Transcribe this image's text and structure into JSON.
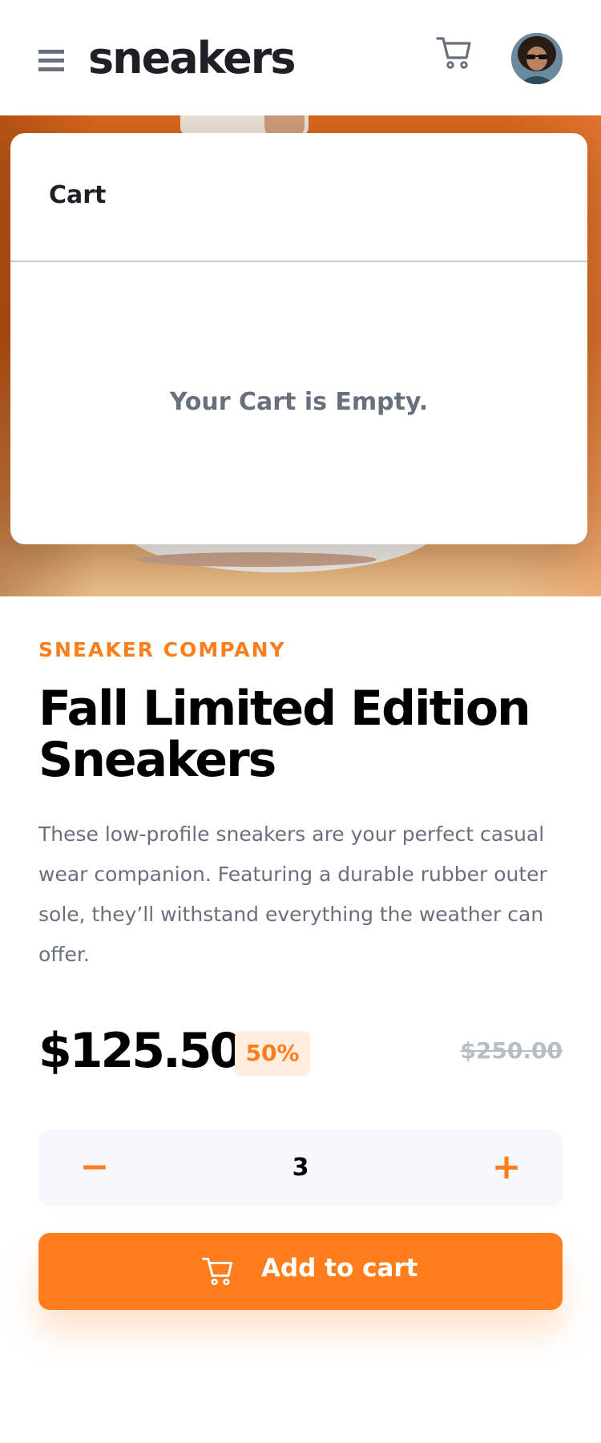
{
  "header": {
    "logo": "sneakers",
    "menu_icon": "hamburger-menu-icon",
    "cart_icon": "cart-icon",
    "avatar_icon": "user-avatar"
  },
  "cart": {
    "title": "Cart",
    "empty_message": "Your Cart is Empty."
  },
  "product": {
    "company": "SNEAKER COMPANY",
    "title": "Fall Limited Edition Sneakers",
    "description": "These low-profile sneakers are your perfect casual wear companion. Featuring a durable rubber outer sole, they’ll withstand everything the weather can offer.",
    "price": "$125.50",
    "discount": "50%",
    "original_price": "$250.00"
  },
  "quantity": {
    "minus_label": "−",
    "value": "3",
    "plus_label": "+"
  },
  "add_to_cart": {
    "label": "Add to cart",
    "icon": "cart-icon"
  },
  "colors": {
    "accent": "#ff7e1b",
    "accent_pale": "#ffede0",
    "text_dark": "#1d2026",
    "text_gray": "#69707d",
    "text_muted": "#b6bcc8",
    "qty_bg": "#f6f8fd"
  }
}
